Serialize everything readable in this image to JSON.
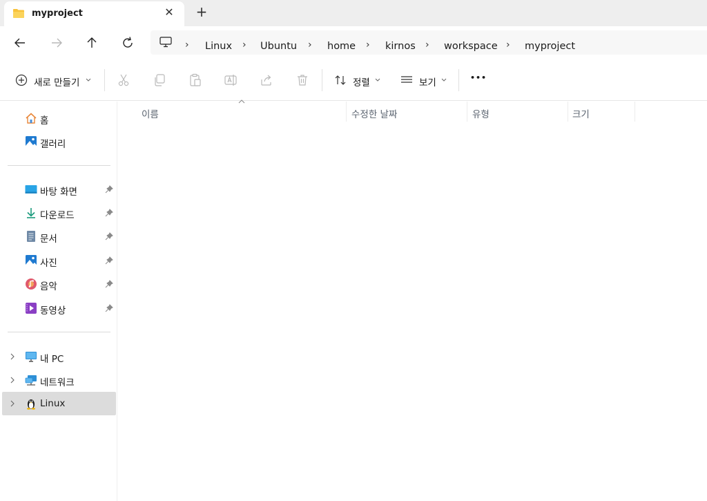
{
  "tab": {
    "title": "myproject",
    "close_glyph": "✕",
    "new_glyph": "+"
  },
  "nav": {
    "back": "back-arrow",
    "forward": "forward-arrow",
    "up": "up-arrow",
    "refresh": "refresh"
  },
  "breadcrumb": [
    "Linux",
    "Ubuntu",
    "home",
    "kirnos",
    "workspace",
    "myproject"
  ],
  "toolbar": {
    "new_label": "새로 만들기",
    "sort_label": "정렬",
    "view_label": "보기",
    "more_glyph": "•••"
  },
  "sidebar": {
    "home": "홈",
    "gallery": "갤러리",
    "quick": [
      "바탕 화면",
      "다운로드",
      "문서",
      "사진",
      "음악",
      "동영상"
    ],
    "thispc": "내 PC",
    "network": "네트워크",
    "linux": "Linux"
  },
  "columns": {
    "name": "이름",
    "modified": "수정한 날짜",
    "type": "유형",
    "size": "크기"
  },
  "colors": {
    "accent": "#0067c0",
    "folder": "#f8c23a",
    "selected": "#dcdcdc"
  }
}
